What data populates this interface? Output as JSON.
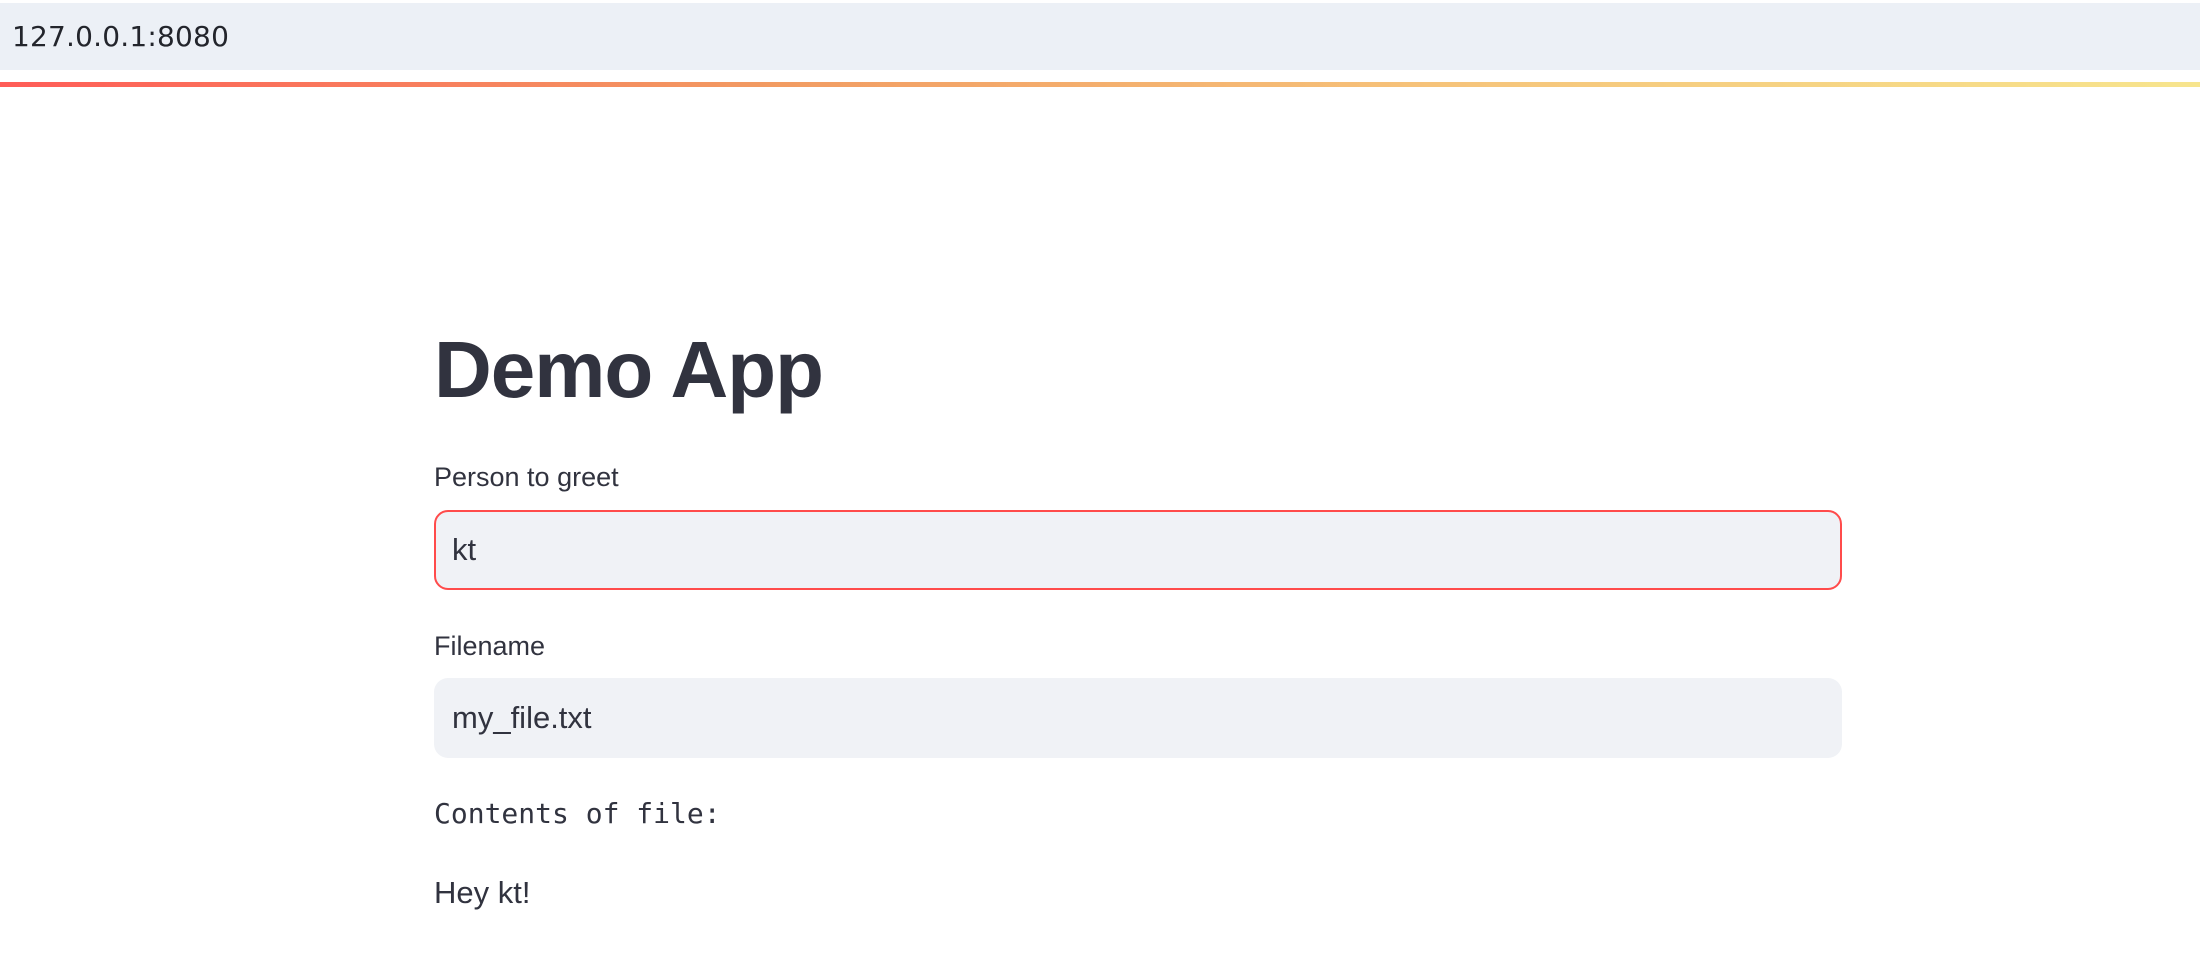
{
  "browser": {
    "url": "127.0.0.1:8080"
  },
  "app": {
    "title": "Demo App",
    "accent_color": "#ff4b4b"
  },
  "form": {
    "person": {
      "label": "Person to greet",
      "value": "kt",
      "focused": true
    },
    "filename": {
      "label": "Filename",
      "value": "my_file.txt",
      "focused": false
    }
  },
  "output": {
    "contents_label": "Contents of file:",
    "greeting": "Hey kt!"
  }
}
